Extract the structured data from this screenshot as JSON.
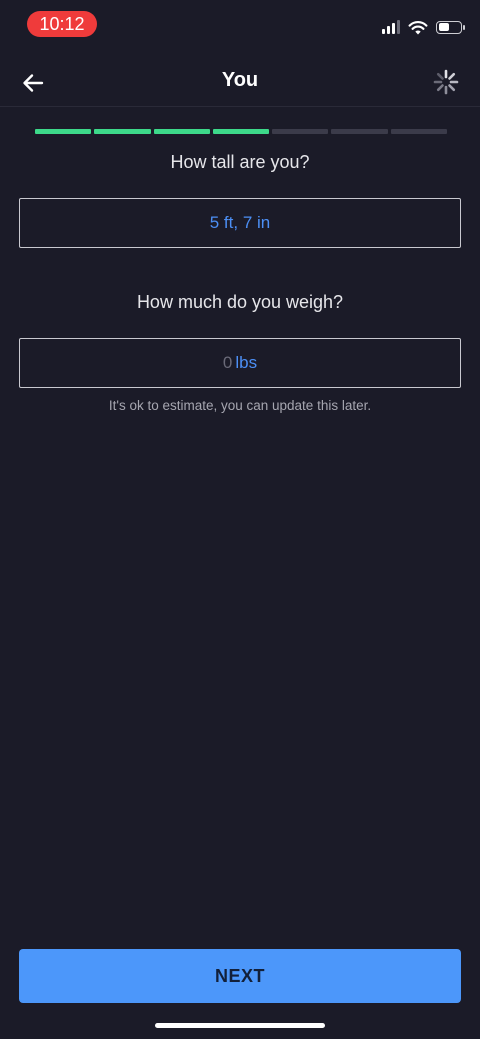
{
  "status_bar": {
    "time": "10:12",
    "signal_icon": "cellular-signal-icon",
    "wifi_icon": "wifi-icon",
    "battery_icon": "battery-icon",
    "battery_level": 0.5
  },
  "nav": {
    "back_icon": "arrow-left-icon",
    "title": "You",
    "loading_icon": "spinner-icon"
  },
  "progress": {
    "steps_total": 7,
    "steps_completed": 4,
    "done_color": "#3dd98a",
    "pending_color": "#3b3b4a"
  },
  "height": {
    "question": "How tall are you?",
    "value": "5 ft, 7 in"
  },
  "weight": {
    "question": "How much do you weigh?",
    "value": "0",
    "unit": "lbs",
    "hint": "It's ok to estimate, you can update this later."
  },
  "next_button": {
    "label": "NEXT"
  },
  "colors": {
    "background": "#1b1b28",
    "accent": "#4c97fa",
    "status_pill": "#ef3b3b"
  }
}
